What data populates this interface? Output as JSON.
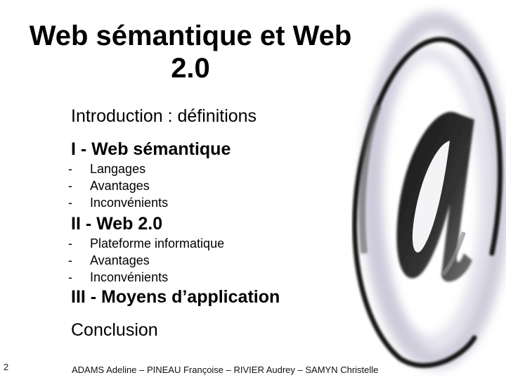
{
  "slide": {
    "title_line1": "Web sémantique et Web",
    "title_line2": "2.0",
    "introduction": "Introduction : définitions",
    "sections": [
      {
        "heading": "I - Web sémantique",
        "items": [
          "Langages",
          "Avantages",
          "Inconvénients"
        ]
      },
      {
        "heading": "II - Web 2.0",
        "items": [
          "Plateforme informatique",
          "Avantages",
          "Inconvénients"
        ]
      },
      {
        "heading": "III - Moyens d’application",
        "items": []
      }
    ],
    "bullet_marker": "-",
    "conclusion": "Conclusion",
    "slide_number": "2",
    "footer": "ADAMS Adeline – PINEAU Françoise – RIVIER Audrey – SAMYN Christelle",
    "decoration_icon": "at-sign-icon"
  }
}
